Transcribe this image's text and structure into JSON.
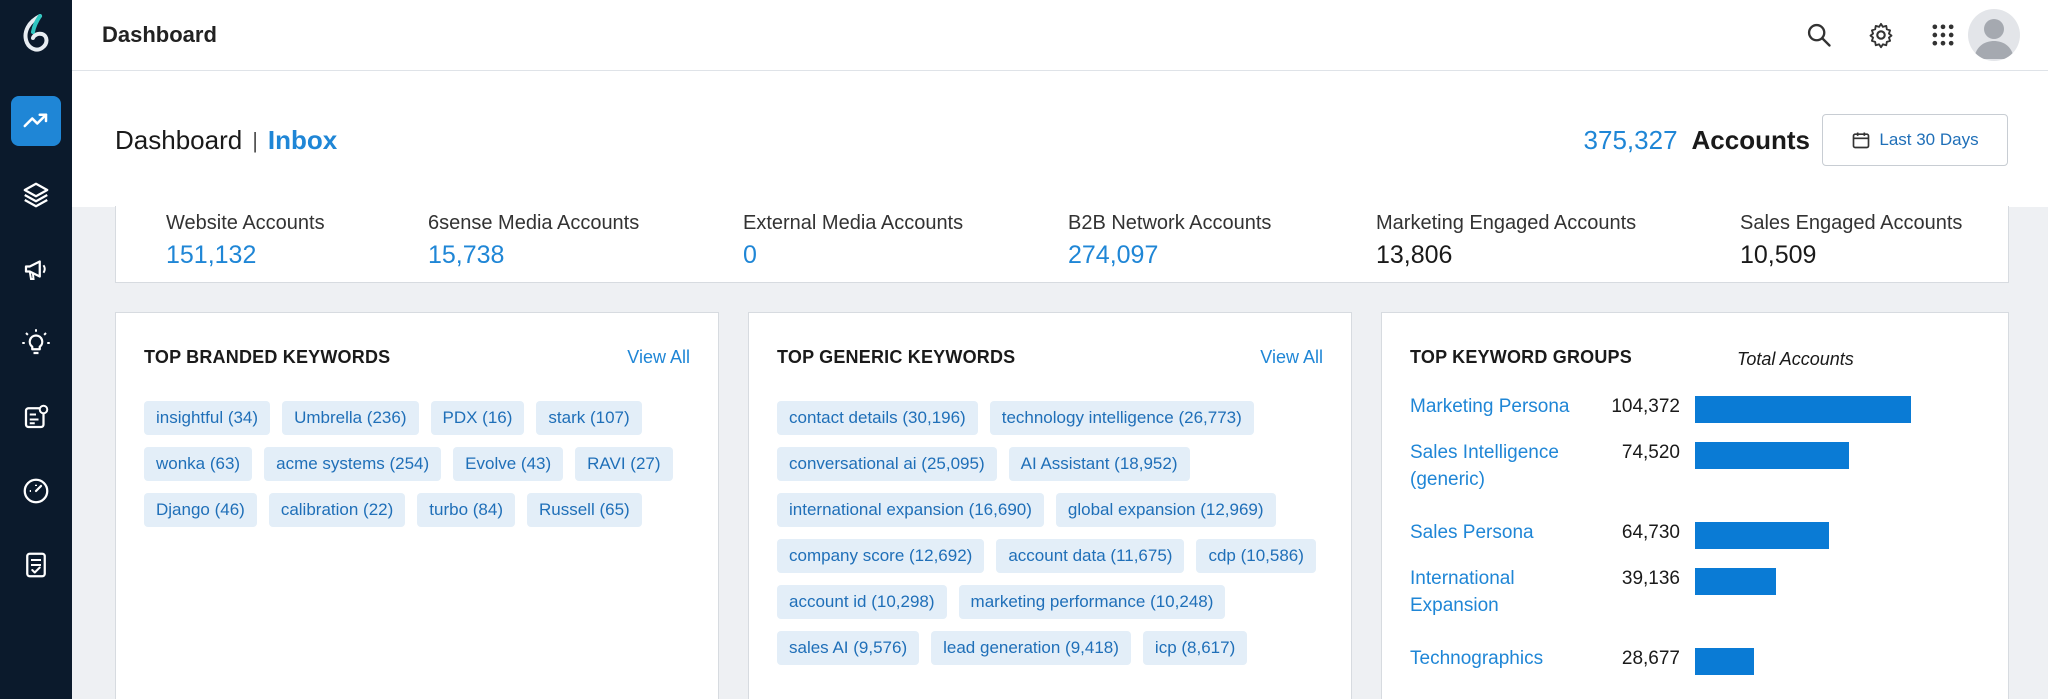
{
  "topbar": {
    "title": "Dashboard"
  },
  "nav": {
    "icons": [
      "trending-icon",
      "layers-icon",
      "megaphone-icon",
      "lightbulb-icon",
      "report-icon",
      "gauge-icon",
      "checklist-icon"
    ]
  },
  "header": {
    "crumb_main": "Dashboard",
    "crumb_sep": "|",
    "crumb_sub": "Inbox",
    "accounts_count": "375,327",
    "accounts_label": "Accounts",
    "date_range": "Last 30 Days"
  },
  "stats": [
    {
      "label": "Website Accounts",
      "value": "151,132"
    },
    {
      "label": "6sense Media Accounts",
      "value": "15,738"
    },
    {
      "label": "External Media Accounts",
      "value": "0"
    },
    {
      "label": "B2B Network Accounts",
      "value": "274,097"
    },
    {
      "label": "Marketing Engaged Accounts",
      "value": "13,806"
    },
    {
      "label": "Sales Engaged Accounts",
      "value": "10,509"
    }
  ],
  "branded": {
    "title": "TOP BRANDED KEYWORDS",
    "view_all": "View All",
    "keywords": [
      "insightful (34)",
      "Umbrella (236)",
      "PDX (16)",
      "stark (107)",
      "wonka (63)",
      "acme systems (254)",
      "Evolve (43)",
      "RAVI (27)",
      "Django (46)",
      "calibration (22)",
      "turbo (84)",
      "Russell (65)"
    ]
  },
  "generic": {
    "title": "TOP GENERIC KEYWORDS",
    "view_all": "View All",
    "keywords": [
      "contact details (30,196)",
      "technology intelligence (26,773)",
      "conversational ai (25,095)",
      "AI Assistant (18,952)",
      "international expansion (16,690)",
      "global expansion (12,969)",
      "company score (12,692)",
      "account data (11,675)",
      "cdp (10,586)",
      "account id (10,298)",
      "marketing performance (10,248)",
      "sales AI (9,576)",
      "lead generation (9,418)",
      "icp (8,617)"
    ]
  },
  "groups": {
    "title": "TOP KEYWORD GROUPS",
    "column_label": "Total Accounts",
    "rows": [
      {
        "name": "Marketing Persona",
        "value": "104,372",
        "amount": 104372
      },
      {
        "name": "Sales Intelligence (generic)",
        "value": "74,520",
        "amount": 74520
      },
      {
        "name": "Sales Persona",
        "value": "64,730",
        "amount": 64730
      },
      {
        "name": "International Expansion",
        "value": "39,136",
        "amount": 39136
      },
      {
        "name": "Technographics",
        "value": "28,677",
        "amount": 28677
      }
    ]
  },
  "colors": {
    "accent": "#1f86d6",
    "nav_bg": "#0b1a2c",
    "chip_bg": "#e3eef8",
    "bar": "#0a7bd5"
  }
}
